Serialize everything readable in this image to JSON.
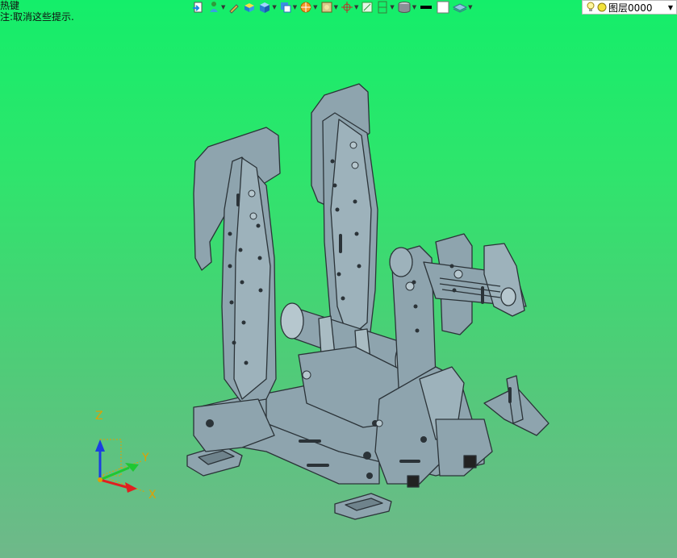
{
  "hint": {
    "line1": "热键",
    "line2": "注:取消这些提示."
  },
  "toolbar": {
    "items": [
      {
        "icon": "document-arrow-icon"
      },
      {
        "icon": "person-layer-icon"
      },
      {
        "icon": "pencil-icon"
      },
      {
        "icon": "yellow-box-icon"
      },
      {
        "icon": "blue-cube-icon"
      },
      {
        "icon": "cube-window-icon"
      },
      {
        "icon": "orange-sphere-icon"
      },
      {
        "icon": "render-frame-icon"
      },
      {
        "icon": "crosshair-icon"
      },
      {
        "icon": "green-frame-icon"
      },
      {
        "icon": "section-icon"
      },
      {
        "icon": "cylinder-icon"
      },
      {
        "icon": "black-line-icon"
      },
      {
        "icon": "white-square-icon"
      },
      {
        "icon": "layers-icon"
      }
    ],
    "layer": {
      "name": "图层0000",
      "bulb_icon": "lightbulb-icon",
      "dot_icon": "yellow-dot-icon"
    }
  },
  "triad": {
    "z_label": "Z",
    "y_label": "Y",
    "x_label": "X"
  },
  "colors": {
    "background_top": "#14ee6a",
    "background_bottom": "#6fb88a",
    "model_fill": "#8ea4ae",
    "model_stroke": "#2b3338",
    "axis_label": "#e0a000",
    "z_axis": "#1a3fe0",
    "y_axis": "#1ec832",
    "x_axis": "#e02020"
  }
}
